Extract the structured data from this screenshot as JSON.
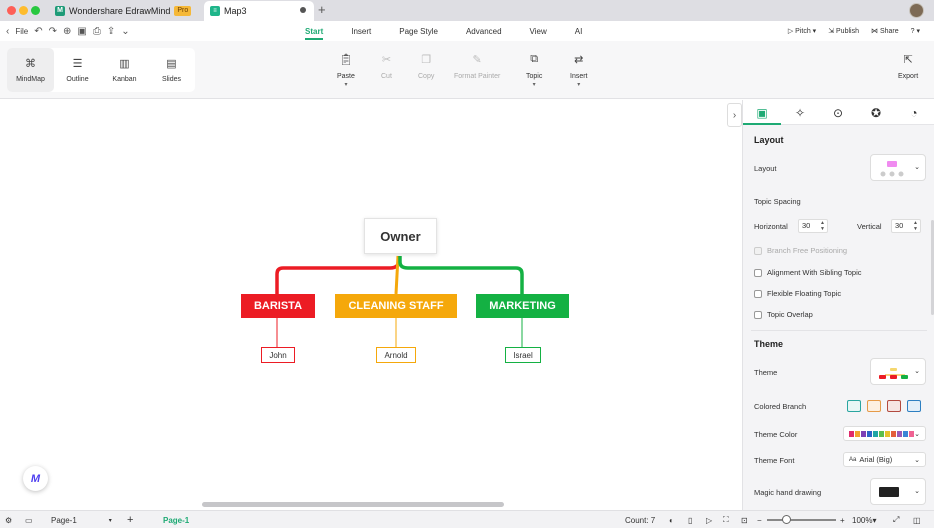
{
  "window": {
    "app_tab_title": "Wondershare EdrawMind",
    "pro_badge": "Pro",
    "doc_tab_title": "Map3"
  },
  "menubar": {
    "file": "File",
    "tabs": [
      "Start",
      "Insert",
      "Page Style",
      "Advanced",
      "View",
      "AI"
    ],
    "active_tab": "Start",
    "pitch": "Pitch",
    "publish": "Publish",
    "share": "Share",
    "help": "?"
  },
  "ribbon": {
    "views": [
      "MindMap",
      "Outline",
      "Kanban",
      "Slides"
    ],
    "active_view": "MindMap",
    "tools": {
      "paste": "Paste",
      "cut": "Cut",
      "copy": "Copy",
      "format_painter": "Format Painter",
      "topic": "Topic",
      "insert": "Insert",
      "export": "Export"
    }
  },
  "mindmap": {
    "root": "Owner",
    "branches": [
      {
        "label": "BARISTA",
        "color": "#ec1c24",
        "child": "John"
      },
      {
        "label": "CLEANING STAFF",
        "color": "#f5a80b",
        "child": "Arnold"
      },
      {
        "label": "MARKETING",
        "color": "#14b143",
        "child": "Israel"
      }
    ]
  },
  "panel": {
    "layout_section": "Layout",
    "layout_label": "Layout",
    "topic_spacing": "Topic Spacing",
    "horizontal_label": "Horizontal",
    "horizontal_value": "30",
    "vertical_label": "Vertical",
    "vertical_value": "30",
    "checkboxes": [
      {
        "label": "Branch Free Positioning",
        "disabled": true
      },
      {
        "label": "Alignment With Sibling Topic",
        "disabled": false
      },
      {
        "label": "Flexible Floating Topic",
        "disabled": false
      },
      {
        "label": "Topic Overlap",
        "disabled": false
      }
    ],
    "theme_section": "Theme",
    "theme_label": "Theme",
    "colored_branch_label": "Colored Branch",
    "theme_color_label": "Theme Color",
    "theme_font_label": "Theme Font",
    "theme_font_value": "Arial (Big)",
    "magic_hand_label": "Magic hand drawing"
  },
  "statusbar": {
    "page_select": "Page-1",
    "active_page_tab": "Page-1",
    "count": "Count: 7",
    "zoom": "100%"
  }
}
